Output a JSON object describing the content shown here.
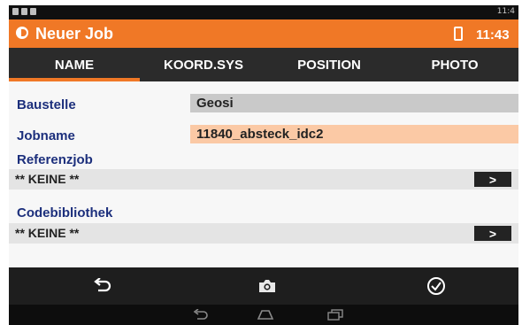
{
  "app": {
    "title": "Neuer Job",
    "time": "11:43",
    "status_right": "11:4"
  },
  "tabs": [
    {
      "label": "NAME",
      "active": true
    },
    {
      "label": "KOORD.SYS",
      "active": false
    },
    {
      "label": "POSITION",
      "active": false
    },
    {
      "label": "PHOTO",
      "active": false
    }
  ],
  "form": {
    "baustelle": {
      "label": "Baustelle",
      "value": "Geosi"
    },
    "jobname": {
      "label": "Jobname",
      "value": "11840_absteck_idc2"
    },
    "referenzjob": {
      "label": "Referenzjob",
      "value": "** KEINE **",
      "button": ">"
    },
    "codebibliothek": {
      "label": "Codebibliothek",
      "value": "** KEINE **",
      "button": ">"
    }
  },
  "icons": {
    "back": "undo-arrow-icon",
    "camera": "camera-icon",
    "confirm": "checkmark-circle-icon",
    "nav_back": "nav-back-icon",
    "nav_home": "nav-home-icon",
    "nav_recent": "nav-recent-apps-icon"
  },
  "colors": {
    "accent": "#f07826",
    "label": "#1c2f7c",
    "tabbar": "#2b2b2b",
    "input_highlight": "#fbc9a5"
  }
}
